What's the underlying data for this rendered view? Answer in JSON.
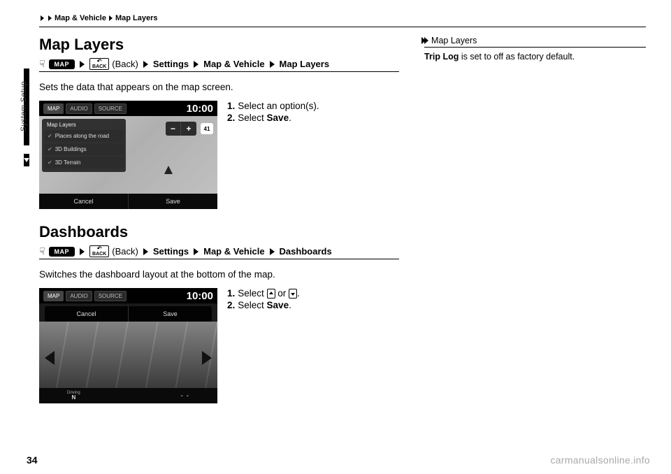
{
  "breadcrumb": {
    "a": "Map & Vehicle",
    "b": "Map Layers"
  },
  "side_tab": "System Setup",
  "page_number": "34",
  "watermark": "carmanualsonline.info",
  "section1": {
    "title": "Map Layers",
    "nav": {
      "map": "MAP",
      "back_label": "(Back)",
      "p1": "Settings",
      "p2": " Map & Vehicle",
      "p3": "Map Layers",
      "back_icon": "BACK"
    },
    "desc": "Sets the data that appears on the map screen.",
    "step1_pre": "Select an option(s).",
    "step2_pre": "Select ",
    "step2_bold": "Save",
    "step2_post": "."
  },
  "section2": {
    "title": "Dashboards",
    "nav": {
      "map": "MAP",
      "back_label": "(Back)",
      "p1": "Settings",
      "p2": " Map & Vehicle",
      "p3": "Dashboards",
      "back_icon": "BACK"
    },
    "desc": "Switches the dashboard layout at the bottom of the map.",
    "step1_pre": "Select ",
    "step1_mid": " or ",
    "step1_post": ".",
    "step2_pre": "Select ",
    "step2_bold": "Save",
    "step2_post": "."
  },
  "callout": {
    "head": "Map Layers",
    "note_b": "Trip Log",
    "note": " is set to off as factory default."
  },
  "ss1": {
    "tabs": [
      "MAP",
      "AUDIO",
      "SOURCE"
    ],
    "clock": "10:00",
    "panel_title": "Map Layers",
    "opts": [
      "Places along the road",
      "3D Buildings",
      "3D Terrain"
    ],
    "shield": "41",
    "cancel": "Cancel",
    "save": "Save"
  },
  "ss2": {
    "tabs": [
      "MAP",
      "AUDIO",
      "SOURCE"
    ],
    "clock": "10:00",
    "cancel": "Cancel",
    "save": "Save",
    "dir_lbl": "Driving",
    "dir": "N",
    "dash": "- -"
  }
}
